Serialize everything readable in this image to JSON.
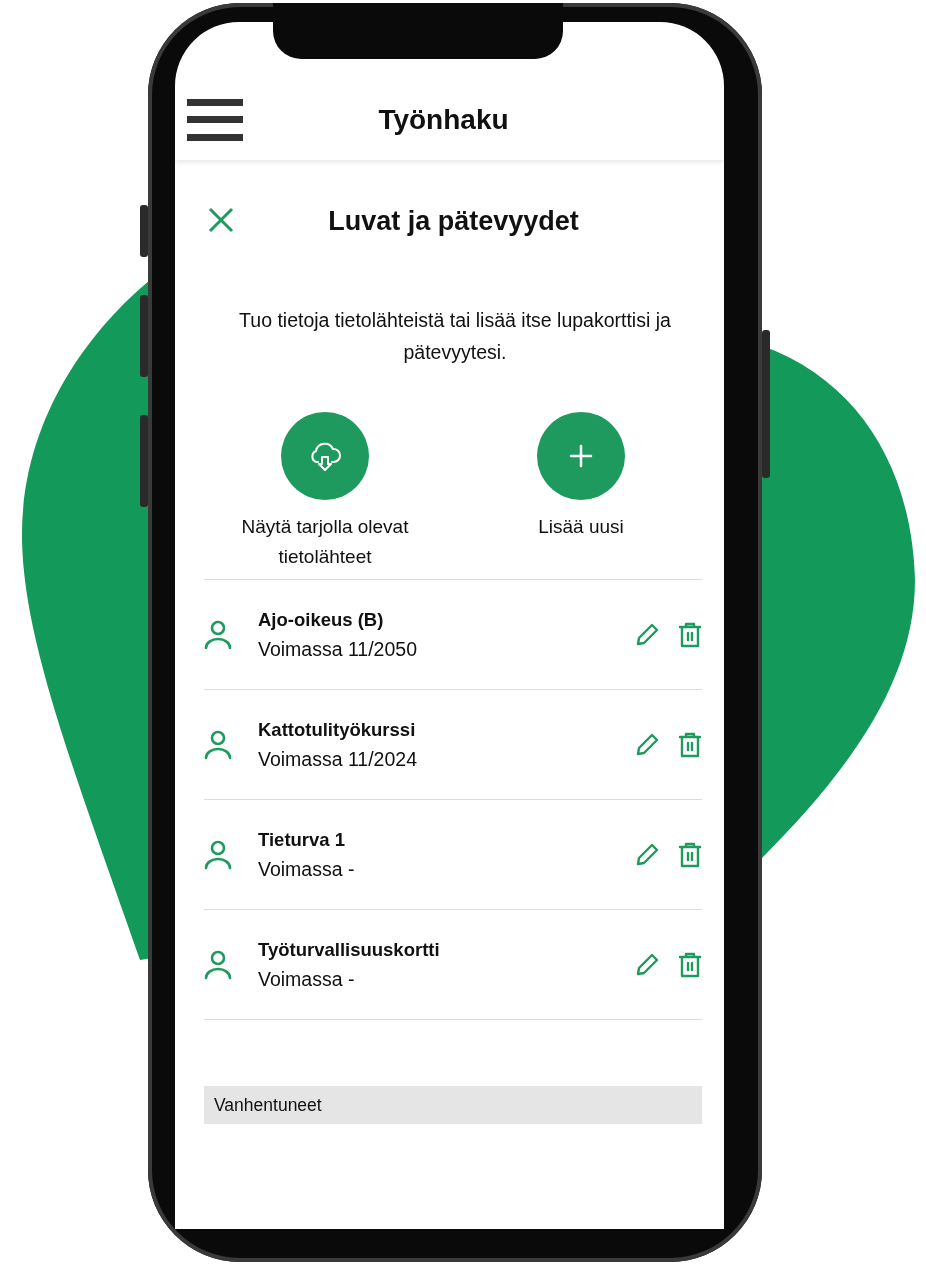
{
  "app_bar": {
    "title": "Työnhaku"
  },
  "dialog": {
    "title": "Luvat ja pätevyydet",
    "intro": "Tuo tietoja tietolähteistä tai lisää itse lupakorttisi ja pätevyytesi."
  },
  "actions": [
    {
      "kind": "import",
      "label": "Näytä tarjolla olevat tietolähteet"
    },
    {
      "kind": "add",
      "label": "Lisää uusi"
    }
  ],
  "items": [
    {
      "name": "Ajo-oikeus (B)",
      "validity": "Voimassa 11/2050"
    },
    {
      "name": "Kattotulityökurssi",
      "validity": "Voimassa 11/2024"
    },
    {
      "name": "Tieturva 1",
      "validity": "Voimassa -"
    },
    {
      "name": "Työturvallisuuskortti",
      "validity": "Voimassa -"
    }
  ],
  "expired_section": {
    "title": "Vanhentuneet"
  }
}
